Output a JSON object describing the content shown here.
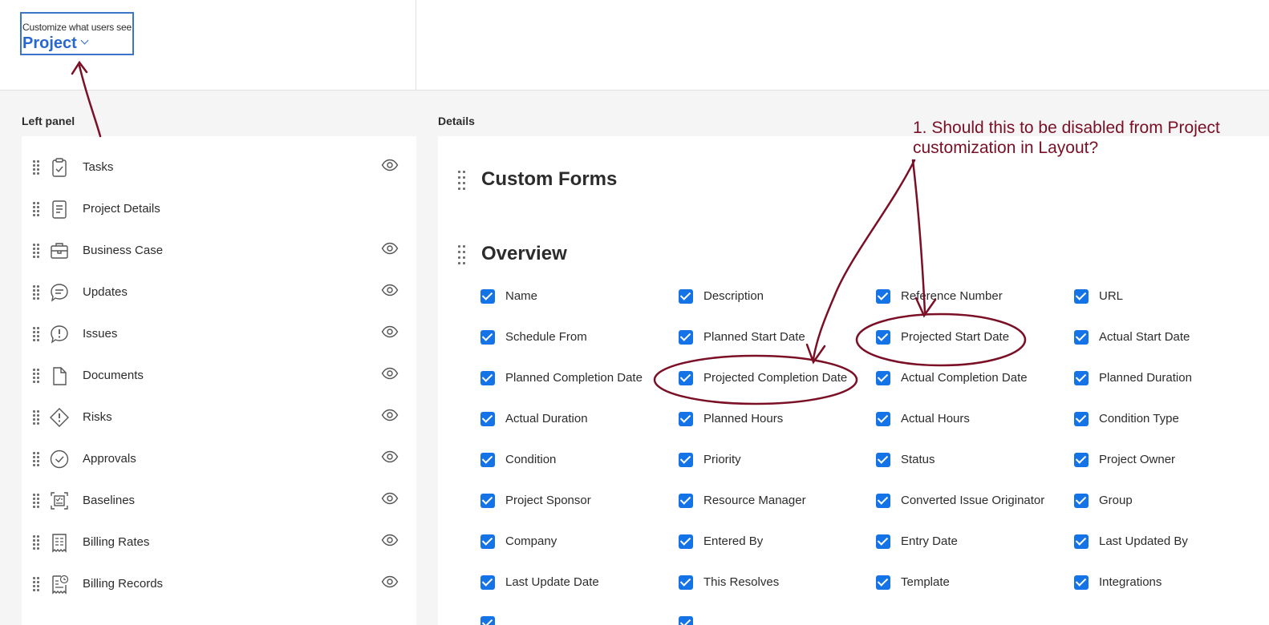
{
  "header": {
    "selector_caption": "Customize what users see",
    "selector_value": "Project"
  },
  "left_panel": {
    "label": "Left panel",
    "items": [
      {
        "label": "Tasks",
        "icon": "clipboard-check-icon",
        "visible_toggle": true
      },
      {
        "label": "Project Details",
        "icon": "document-lines-icon",
        "visible_toggle": false
      },
      {
        "label": "Business Case",
        "icon": "briefcase-icon",
        "visible_toggle": true
      },
      {
        "label": "Updates",
        "icon": "chat-bubble-icon",
        "visible_toggle": true
      },
      {
        "label": "Issues",
        "icon": "alert-bubble-icon",
        "visible_toggle": true
      },
      {
        "label": "Documents",
        "icon": "file-icon",
        "visible_toggle": true
      },
      {
        "label": "Risks",
        "icon": "alert-diamond-icon",
        "visible_toggle": true
      },
      {
        "label": "Approvals",
        "icon": "check-circle-icon",
        "visible_toggle": true
      },
      {
        "label": "Baselines",
        "icon": "baseline-icon",
        "visible_toggle": true
      },
      {
        "label": "Billing Rates",
        "icon": "receipt-icon",
        "visible_toggle": true
      },
      {
        "label": "Billing Records",
        "icon": "receipt-clock-icon",
        "visible_toggle": true
      }
    ]
  },
  "details": {
    "label": "Details",
    "sections": [
      {
        "title": "Custom Forms"
      },
      {
        "title": "Overview"
      }
    ],
    "overview_fields": [
      "Name",
      "Description",
      "Reference Number",
      "URL",
      "Schedule From",
      "Planned Start Date",
      "Projected Start Date",
      "Actual Start Date",
      "Planned Completion Date",
      "Projected Completion Date",
      "Actual Completion Date",
      "Planned Duration",
      "Actual Duration",
      "Planned Hours",
      "Actual Hours",
      "Condition Type",
      "Condition",
      "Priority",
      "Status",
      "Project Owner",
      "Project Sponsor",
      "Resource Manager",
      "Converted Issue Originator",
      "Group",
      "Company",
      "Entered By",
      "Entry Date",
      "Last Updated By",
      "Last Update Date",
      "This Resolves",
      "Template",
      "Integrations"
    ]
  },
  "annotation": {
    "text": "1. Should this to be disabled from Project customization in Layout?",
    "color": "#7a0f25"
  },
  "colors": {
    "accent": "#1473e6",
    "selector_blue": "#2768d0"
  }
}
